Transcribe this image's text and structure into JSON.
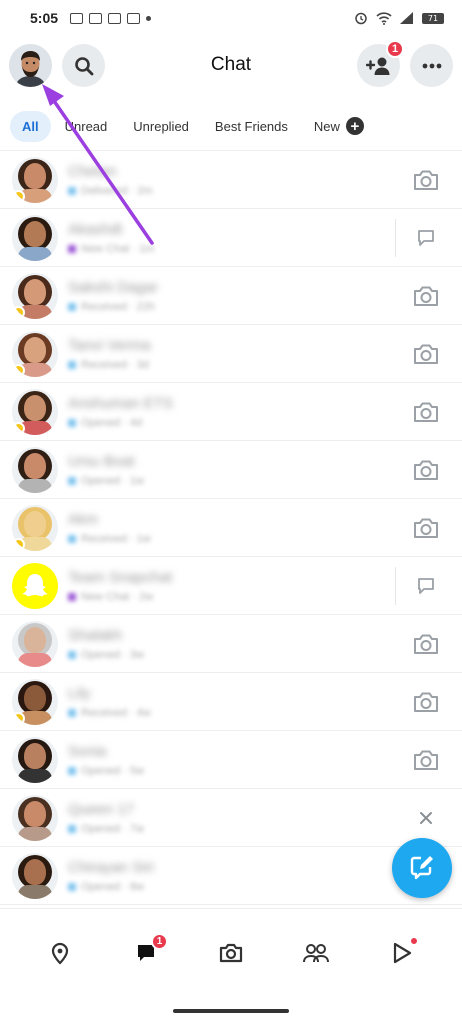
{
  "status_bar": {
    "time": "5:05",
    "battery": "71"
  },
  "header": {
    "title": "Chat",
    "add_friend_badge": "1"
  },
  "tabs": [
    {
      "label": "All",
      "active": true
    },
    {
      "label": "Unread",
      "active": false
    },
    {
      "label": "Unreplied",
      "active": false
    },
    {
      "label": "Best Friends",
      "active": false
    },
    {
      "label": "New",
      "active": false
    }
  ],
  "chats": [
    {
      "name": "Chetan",
      "status": "Delivered · 2m",
      "kind": "snap",
      "action": "camera-icon",
      "streak": true,
      "skin": "#c98a6a",
      "hair": "#3b2418",
      "shirt": "#d8a07a"
    },
    {
      "name": "Akashdt",
      "status": "New Chat · 1m",
      "kind": "chat",
      "action": "chat-bubble-icon",
      "streak": false,
      "skin": "#b27a55",
      "hair": "#2a1a10",
      "shirt": "#8aa6c8"
    },
    {
      "name": "Sakshi Dagar",
      "status": "Received · 22h",
      "kind": "snap",
      "action": "camera-icon",
      "streak": true,
      "skin": "#d49a78",
      "hair": "#4a2a1a",
      "shirt": "#c47c66"
    },
    {
      "name": "Tanvi Verma",
      "status": "Received · 3d",
      "kind": "snap",
      "action": "camera-icon",
      "streak": true,
      "skin": "#d8a27e",
      "hair": "#6a3a22",
      "shirt": "#d99a8a"
    },
    {
      "name": "Anshuman ETS",
      "status": "Opened · 4d",
      "kind": "snap",
      "action": "camera-icon",
      "streak": true,
      "skin": "#c8906c",
      "hair": "#3a2416",
      "shirt": "#d25b5b"
    },
    {
      "name": "Ursu Boat",
      "status": "Opened · 1w",
      "kind": "snap",
      "action": "camera-icon",
      "streak": false,
      "skin": "#c98a6a",
      "hair": "#2e1e14",
      "shirt": "#b3b3b3"
    },
    {
      "name": "Akm",
      "status": "Received · 1w",
      "kind": "snap",
      "action": "camera-icon",
      "streak": true,
      "skin": "#f0cf8e",
      "hair": "#e9c26a",
      "shirt": "#f0d89a"
    },
    {
      "name": "Team Snapchat",
      "status": "New Chat · 2w",
      "kind": "chat",
      "action": "chat-bubble-icon",
      "streak": false,
      "skin": "#fffc00",
      "hair": "#fffc00",
      "shirt": "#fffc00"
    },
    {
      "name": "Shalakh",
      "status": "Opened · 3w",
      "kind": "snap",
      "action": "camera-icon",
      "streak": false,
      "skin": "#d9b49a",
      "hair": "#c8c8c8",
      "shirt": "#e98a8a"
    },
    {
      "name": "Lily",
      "status": "Received · 4w",
      "kind": "snap",
      "action": "camera-icon",
      "streak": true,
      "skin": "#8a5a3a",
      "hair": "#2a1810",
      "shirt": "#c89060"
    },
    {
      "name": "Sonia",
      "status": "Opened · 5w",
      "kind": "snap",
      "action": "camera-icon",
      "streak": false,
      "skin": "#b98060",
      "hair": "#241810",
      "shirt": "#333333"
    },
    {
      "name": "Queen 17",
      "status": "Opened · 7w",
      "kind": "snap",
      "action": "close-icon",
      "streak": false,
      "skin": "#c98a6a",
      "hair": "#4a3020",
      "shirt": "#b89a8a"
    },
    {
      "name": "Chirayan Siri",
      "status": "Opened · 8w",
      "kind": "snap",
      "action": "none",
      "streak": false,
      "skin": "#a8704e",
      "hair": "#2a1a10",
      "shirt": "#8a7a6a"
    }
  ],
  "bottom_nav": {
    "chat_badge": "1"
  },
  "colors": {
    "accent": "#1ea8f0",
    "badge": "#e8394d",
    "active_tab_bg": "#e3f0fb",
    "active_tab_text": "#1d6fd6",
    "annotation_arrow": "#9b3fe0"
  }
}
